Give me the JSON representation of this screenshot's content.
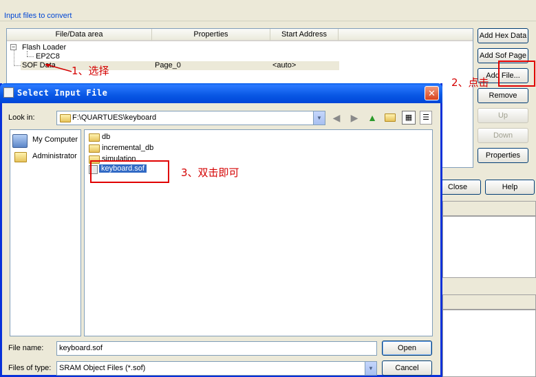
{
  "main_window": {
    "group_label": "Input files to convert",
    "columns": [
      "File/Data area",
      "Properties",
      "Start Address"
    ],
    "tree": {
      "root": "Flash Loader",
      "child": "EP2C8",
      "sof": "SOF Data",
      "sof_page": "Page_0",
      "sof_address": "<auto>"
    },
    "side_buttons": {
      "add_hex": "Add Hex Data",
      "add_sof_page": "Add Sof Page",
      "add_file": "Add File...",
      "remove": "Remove",
      "up": "Up",
      "down": "Down",
      "properties": "Properties"
    },
    "close": "Close",
    "help": "Help"
  },
  "annotations": {
    "step1": "1、选择",
    "step2": "2、点击",
    "step3": "3、双击即可"
  },
  "dialog": {
    "title": "Select Input File",
    "look_in_label": "Look in:",
    "look_in_value": "F:\\QUARTUES\\keyboard",
    "places": [
      "My Computer",
      "Administrator"
    ],
    "files": [
      "db",
      "incremental_db",
      "simulation",
      "keyboard.sof"
    ],
    "file_name_label": "File name:",
    "file_name_value": "keyboard.sof",
    "file_type_label": "Files of type:",
    "file_type_value": "SRAM Object Files (*.sof)",
    "open": "Open",
    "cancel": "Cancel"
  }
}
